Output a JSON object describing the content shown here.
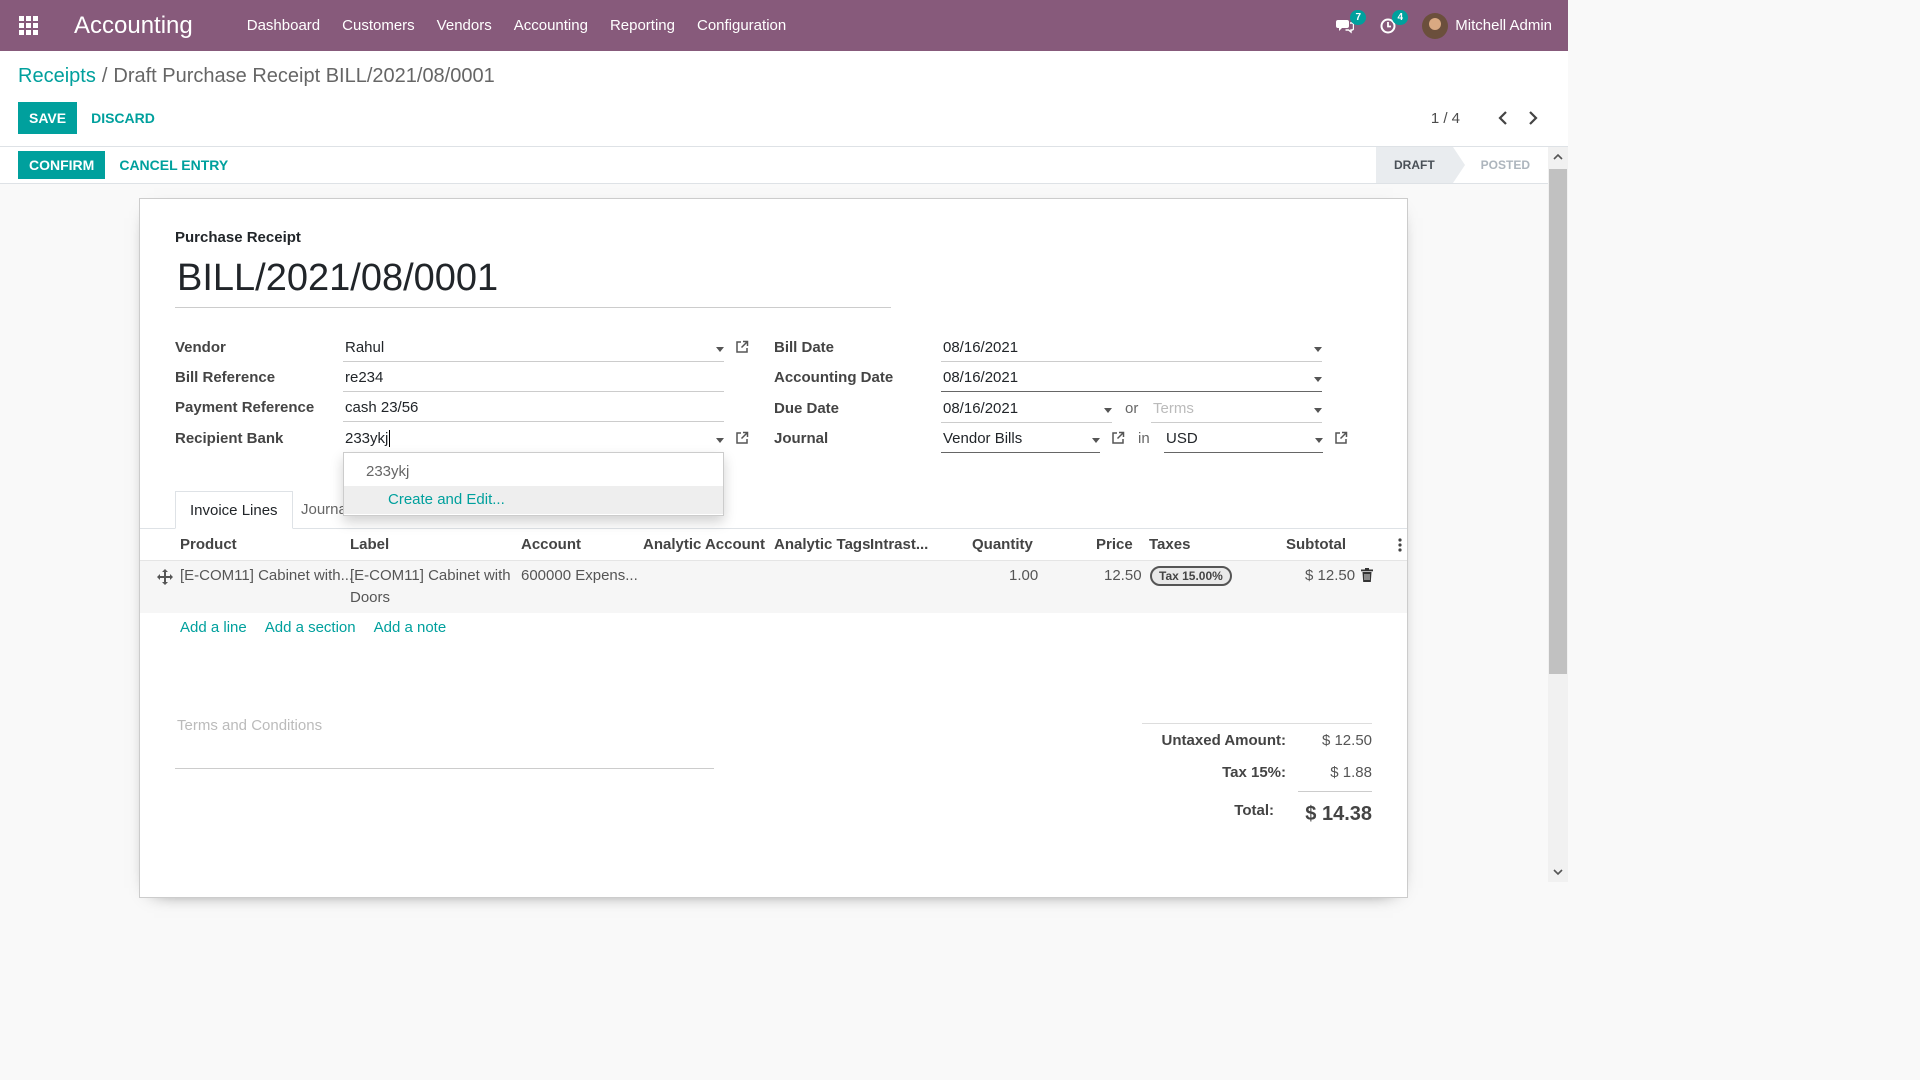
{
  "navbar": {
    "app_title": "Accounting",
    "menu": [
      "Dashboard",
      "Customers",
      "Vendors",
      "Accounting",
      "Reporting",
      "Configuration"
    ],
    "messages_count": "7",
    "activities_count": "4",
    "user_name": "Mitchell Admin",
    "bg_color": "#875a7b"
  },
  "breadcrumb": {
    "parent": "Receipts",
    "separator": "/",
    "current": "Draft Purchase Receipt BILL/2021/08/0001"
  },
  "control": {
    "save_label": "SAVE",
    "discard_label": "DISCARD",
    "pager_value": "1 / 4"
  },
  "statusbar": {
    "confirm_label": "CONFIRM",
    "cancel_label": "CANCEL ENTRY",
    "stages": [
      "DRAFT",
      "POSTED"
    ],
    "active_stage": "DRAFT"
  },
  "form": {
    "doc_type": "Purchase Receipt",
    "doc_name": "BILL/2021/08/0001",
    "left": {
      "vendor_label": "Vendor",
      "vendor_value": "Rahul",
      "bill_ref_label": "Bill Reference",
      "bill_ref_value": "re234",
      "payment_ref_label": "Payment Reference",
      "payment_ref_value": "cash 23/56",
      "recipient_bank_label": "Recipient Bank",
      "recipient_bank_value": "233ykj"
    },
    "right": {
      "bill_date_label": "Bill Date",
      "bill_date_value": "08/16/2021",
      "accounting_date_label": "Accounting Date",
      "accounting_date_value": "08/16/2021",
      "due_date_label": "Due Date",
      "due_date_value": "08/16/2021",
      "or_text": "or",
      "terms_placeholder": "Terms",
      "journal_label": "Journal",
      "journal_value": "Vendor Bills",
      "in_text": "in",
      "currency_value": "USD"
    },
    "dropdown": {
      "option": "233ykj",
      "create_label": "Create and Edit..."
    },
    "tabs": [
      "Invoice Lines",
      "Journa"
    ],
    "table": {
      "headers": [
        "Product",
        "Label",
        "Account",
        "Analytic Account",
        "Analytic Tags",
        "Intrast...",
        "Quantity",
        "Price",
        "Taxes",
        "Subtotal"
      ],
      "row": {
        "product": "[E-COM11] Cabinet with...",
        "label": "[E-COM11] Cabinet with Doors",
        "account": "600000 Expens...",
        "quantity": "1.00",
        "price": "12.50",
        "tax": "Tax 15.00%",
        "subtotal": "$ 12.50"
      }
    },
    "add_links": [
      "Add a line",
      "Add a section",
      "Add a note"
    ],
    "terms_placeholder": "Terms and Conditions",
    "totals": {
      "untaxed_label": "Untaxed Amount:",
      "untaxed_value": "$ 12.50",
      "tax_label": "Tax 15%:",
      "tax_value": "$ 1.88",
      "total_label": "Total:",
      "total_value": "$ 14.38"
    }
  },
  "colors": {
    "primary": "#00a09d",
    "brand": "#875a7b"
  }
}
